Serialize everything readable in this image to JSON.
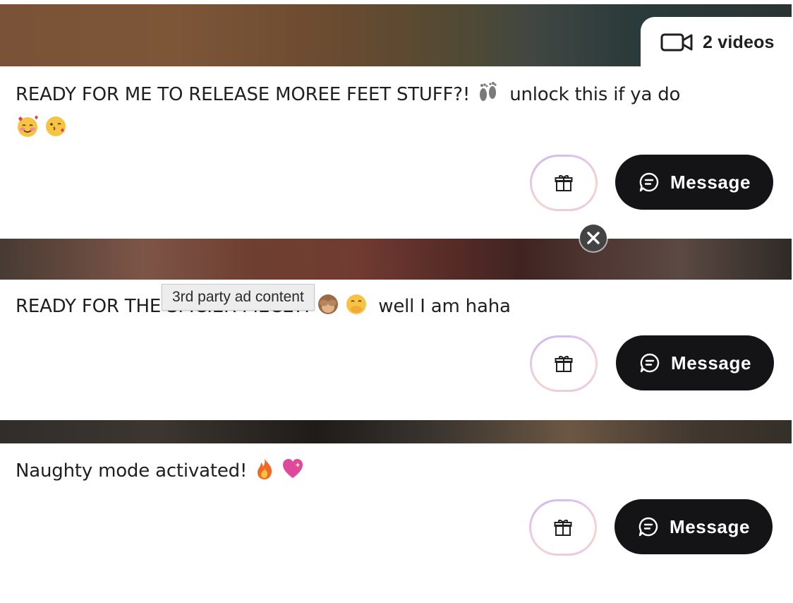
{
  "posts": [
    {
      "media_label": "2 videos",
      "caption_prefix": "READY FOR ME TO RELEASE MOREE FEET STUFF?! ",
      "caption_suffix": " unlock this if ya do",
      "emojis": [
        "footprints",
        "smiling-face-with-hearts",
        "face-blowing-kiss"
      ],
      "message_label": "Message"
    },
    {
      "caption_prefix": "READY FOR TH",
      "caption_hidden_part": "E SPICIER PIECE",
      "caption_after_tooltip": "?! ",
      "caption_suffix": " well I am haha",
      "emojis": [
        "see-no-evil-monkey",
        "face-with-hand-over-mouth"
      ],
      "message_label": "Message"
    },
    {
      "caption_prefix": "Naughty mode activated! ",
      "emojis": [
        "fire",
        "sparkling-heart"
      ],
      "message_label": "Message"
    }
  ],
  "ad": {
    "tooltip": "3rd party ad content",
    "close_icon": "close-icon"
  },
  "colors": {
    "button_bg": "#141416",
    "button_text": "#ffffff",
    "gift_border": "#d9c4f0"
  }
}
